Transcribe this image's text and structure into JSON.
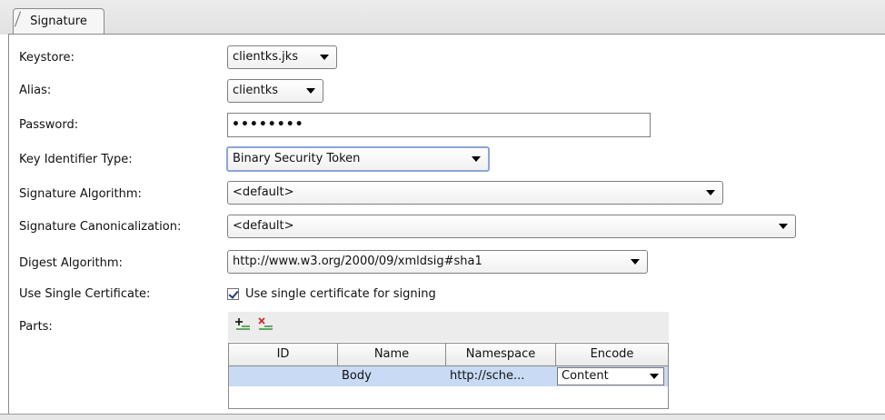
{
  "tab": {
    "label": "Signature"
  },
  "fields": {
    "keystore": {
      "label": "Keystore:",
      "value": "clientks.jks"
    },
    "alias": {
      "label": "Alias:",
      "value": "clientks"
    },
    "password": {
      "label": "Password:",
      "value": "••••••••"
    },
    "key_identifier_type": {
      "label": "Key Identifier Type:",
      "value": "Binary Security Token"
    },
    "signature_algorithm": {
      "label": "Signature Algorithm:",
      "value": "<default>"
    },
    "signature_canonicalization": {
      "label": "Signature Canonicalization:",
      "value": "<default>"
    },
    "digest_algorithm": {
      "label": "Digest Algorithm:",
      "value": "http://www.w3.org/2000/09/xmldsig#sha1"
    },
    "use_single_certificate": {
      "label": "Use Single Certificate:",
      "checkbox_label": "Use single certificate for signing",
      "checked": true
    }
  },
  "parts": {
    "label": "Parts:",
    "toolbar": {
      "add_icon": "add-part-icon",
      "remove_icon": "remove-part-icon"
    },
    "columns": [
      "ID",
      "Name",
      "Namespace",
      "Encode"
    ],
    "rows": [
      {
        "id": "",
        "name": "Body",
        "namespace": "http://sche...",
        "encode": "Content"
      }
    ]
  },
  "colors": {
    "selection": "#c8daf4",
    "focus_border": "#8aa7d6"
  }
}
